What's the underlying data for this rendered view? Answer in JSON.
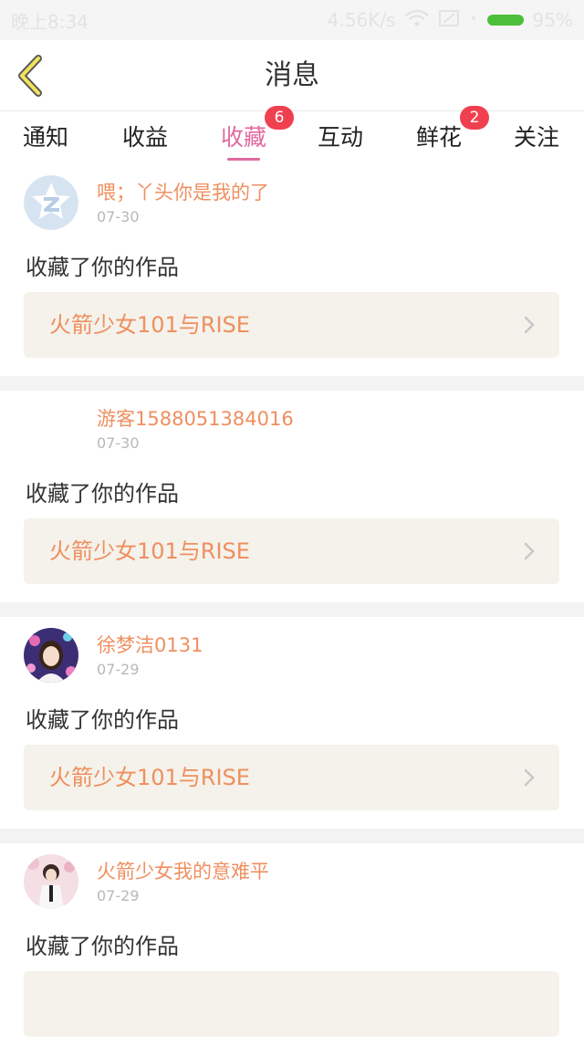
{
  "status_bar": {
    "time": "晚上8:34",
    "net_speed": "4.56K/s",
    "battery_percent": "95%"
  },
  "header": {
    "title": "消息"
  },
  "tabs": [
    {
      "label": "通知",
      "badge": ""
    },
    {
      "label": "收益",
      "badge": ""
    },
    {
      "label": "收藏",
      "badge": "6",
      "active": true
    },
    {
      "label": "互动",
      "badge": ""
    },
    {
      "label": "鲜花",
      "badge": "2"
    },
    {
      "label": "关注",
      "badge": ""
    }
  ],
  "feed": [
    {
      "user": "喂；丫头你是我的了",
      "date": "07-30",
      "action": "收藏了你的作品",
      "work": "火箭少女101与RISE"
    },
    {
      "user": "游客1588051384016",
      "date": "07-30",
      "action": "收藏了你的作品",
      "work": "火箭少女101与RISE"
    },
    {
      "user": "徐梦洁0131",
      "date": "07-29",
      "action": "收藏了你的作品",
      "work": "火箭少女101与RISE"
    },
    {
      "user": "火箭少女我的意难平",
      "date": "07-29",
      "action": "收藏了你的作品",
      "work": ""
    }
  ],
  "colors": {
    "accent": "#e06aa0",
    "badge": "#f04050",
    "name": "#ef8f5f",
    "work_bg": "#f4f2eb"
  }
}
